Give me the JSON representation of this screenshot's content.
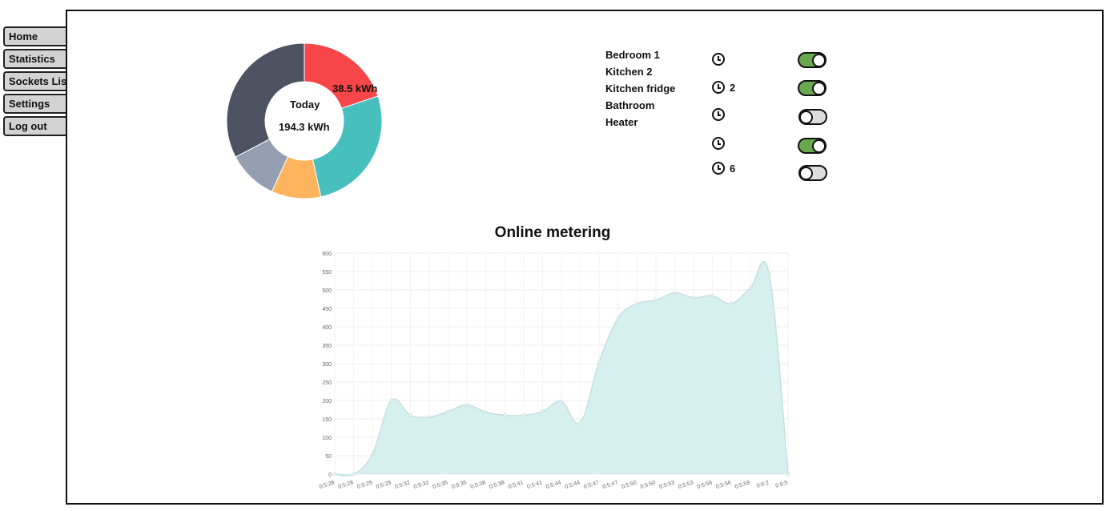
{
  "nav": {
    "items": [
      {
        "label": "Home"
      },
      {
        "label": "Statistics"
      },
      {
        "label": "Sockets List"
      },
      {
        "label": "Settings"
      },
      {
        "label": "Log out"
      }
    ]
  },
  "donut": {
    "center_title": "Today",
    "center_value": "194.3 kWh",
    "slice_label": "38.5 kWh",
    "slices": [
      {
        "value": 38.5,
        "color": "#f7464a"
      },
      {
        "value": 52.0,
        "color": "#46bfbd"
      },
      {
        "value": 20.0,
        "color": "#fdb45c"
      },
      {
        "value": 20.3,
        "color": "#949fb1"
      },
      {
        "value": 63.5,
        "color": "#4d5360"
      }
    ]
  },
  "sockets": {
    "names": [
      "Bedroom 1",
      "Kitchen 2",
      "Kitchen fridge",
      "Bathroom",
      "Heater"
    ],
    "timers": [
      {
        "icon": "clock-icon",
        "text": ""
      },
      {
        "icon": "clock-icon",
        "text": "2"
      },
      {
        "icon": "clock-icon",
        "text": ""
      },
      {
        "icon": "clock-icon",
        "text": ""
      },
      {
        "icon": "clock-icon",
        "text": "6"
      }
    ],
    "toggles": [
      {
        "state": "on",
        "color": "#6aa84f"
      },
      {
        "state": "on",
        "color": "#6aa84f"
      },
      {
        "state": "off",
        "color": "#dcdcdc"
      },
      {
        "state": "on",
        "color": "#6aa84f"
      },
      {
        "state": "off",
        "color": "#dcdcdc"
      }
    ]
  },
  "metering": {
    "title": "Online metering"
  },
  "chart_data": {
    "type": "area",
    "title": "Online metering",
    "xlabel": "",
    "ylabel": "",
    "ylim": [
      0,
      600
    ],
    "yticks": [
      0,
      50,
      100,
      150,
      200,
      250,
      300,
      350,
      400,
      450,
      500,
      550,
      600
    ],
    "grid": true,
    "fill_color": "#d6f0f0",
    "line_color": "#c8dede",
    "x": [
      "0:5:28",
      "0:5:28",
      "0:5:29",
      "0:5:29",
      "0:5:32",
      "0:5:32",
      "0:5:35",
      "0:5:35",
      "0:5:38",
      "0:5:38",
      "0:5:41",
      "0:5:41",
      "0:5:44",
      "0:5:44",
      "0:5:47",
      "0:5:47",
      "0:5:50",
      "0:5:50",
      "0:5:53",
      "0:5:53",
      "0:5:56",
      "0:5:56",
      "0:5:59",
      "0:6:2",
      "0:6:5"
    ],
    "values": [
      0,
      0,
      55,
      200,
      160,
      155,
      170,
      188,
      168,
      160,
      160,
      170,
      197,
      140,
      305,
      423,
      463,
      472,
      492,
      479,
      484,
      463,
      505,
      542,
      0
    ]
  }
}
